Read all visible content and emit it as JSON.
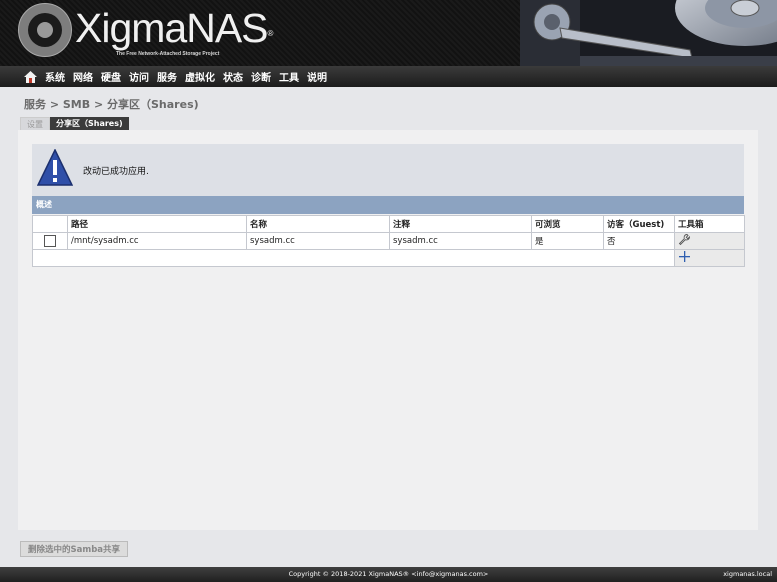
{
  "header": {
    "brand": "XigmaNAS",
    "trademark": "®",
    "tagline": "The Free Network-Attached Storage Project"
  },
  "topnav": {
    "items": [
      "系统",
      "网络",
      "硬盘",
      "访问",
      "服务",
      "虚拟化",
      "状态",
      "诊断",
      "工具",
      "说明"
    ]
  },
  "page": {
    "title": "服务 > SMB > 分享区（Shares)",
    "tabs": [
      {
        "label": "设置",
        "active": false
      },
      {
        "label": "分享区（Shares)",
        "active": true
      }
    ]
  },
  "alert": {
    "icon": "warning-icon",
    "message": "改动已成功应用."
  },
  "table": {
    "title": "概述",
    "columns": [
      "",
      "路径",
      "名称",
      "注释",
      "可浏览",
      "访客（Guest)",
      "工具箱"
    ],
    "rows": [
      {
        "checked": false,
        "path": "/mnt/sysadm.cc",
        "name": "sysadm.cc",
        "comment": "sysadm.cc",
        "browsable": "是",
        "guest": "否"
      }
    ],
    "row_tool_icon": "wrench-icon",
    "add_icon": "plus-icon"
  },
  "actions": {
    "delete_label": "删除选中的Samba共享"
  },
  "footer": {
    "copyright": "Copyright © 2018-2021 XigmaNAS® <info@xigmanas.com>",
    "host": "xigmanas.local"
  },
  "colors": {
    "nav_bg": "#2a2a2a",
    "table_title_bg": "#8ca3c1",
    "alert_bg": "#dde0e6",
    "alert_icon": "#2f4fa8"
  }
}
